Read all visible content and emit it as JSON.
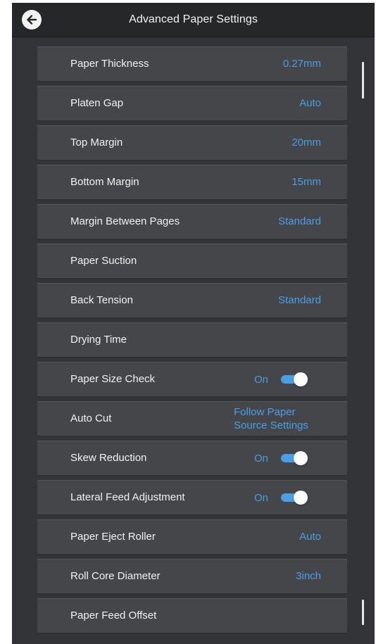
{
  "header": {
    "title": "Advanced Paper Settings",
    "back_icon": "arrow-left-icon"
  },
  "accent_color": "#4a9ee6",
  "settings": [
    {
      "label": "Paper Thickness",
      "type": "value",
      "value": "0.27mm"
    },
    {
      "label": "Platen Gap",
      "type": "value",
      "value": "Auto"
    },
    {
      "label": "Top Margin",
      "type": "value",
      "value": "20mm"
    },
    {
      "label": "Bottom Margin",
      "type": "value",
      "value": "15mm"
    },
    {
      "label": "Margin Between Pages",
      "type": "value",
      "value": "Standard"
    },
    {
      "label": "Paper Suction",
      "type": "none",
      "value": ""
    },
    {
      "label": "Back Tension",
      "type": "value",
      "value": "Standard"
    },
    {
      "label": "Drying Time",
      "type": "none",
      "value": ""
    },
    {
      "label": "Paper Size Check",
      "type": "toggle",
      "value": "On",
      "enabled": true
    },
    {
      "label": "Auto Cut",
      "type": "value2",
      "value": "Follow Paper Source Settings"
    },
    {
      "label": "Skew Reduction",
      "type": "toggle",
      "value": "On",
      "enabled": true
    },
    {
      "label": "Lateral Feed Adjustment",
      "type": "toggle",
      "value": "On",
      "enabled": true
    },
    {
      "label": "Paper Eject Roller",
      "type": "value",
      "value": "Auto"
    },
    {
      "label": "Roll Core Diameter",
      "type": "value",
      "value": "3inch"
    },
    {
      "label": "Paper Feed Offset",
      "type": "none",
      "value": ""
    }
  ]
}
